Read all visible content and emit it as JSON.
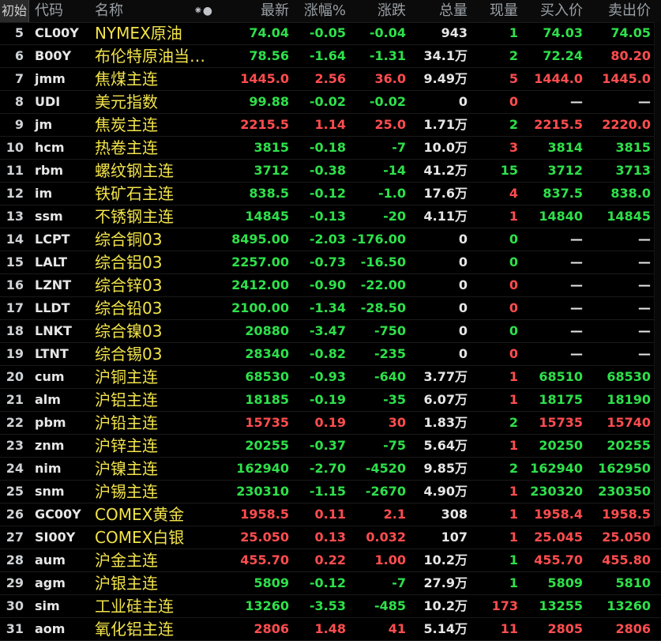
{
  "header": {
    "first_button": "初始",
    "code": "代码",
    "name": "名称",
    "icons": "⁕●",
    "last": "最新",
    "pct": "涨幅%",
    "chg": "涨跌",
    "vol": "总量",
    "now": "现量",
    "bid": "买入价",
    "ask": "卖出价"
  },
  "colors": {
    "up": "#ff4d4f",
    "down": "#2ee04b",
    "flat": "#e6e6e6",
    "name": "#f2e34a"
  },
  "rows": [
    {
      "idx": "5",
      "code": "CL00Y",
      "name": "NYMEX原油",
      "last": "74.04",
      "last_dir": "down",
      "pct": "-0.05",
      "pct_dir": "down",
      "chg": "-0.04",
      "chg_dir": "down",
      "vol": "943",
      "now": "1",
      "now_dir": "down",
      "bid": "74.03",
      "bid_dir": "down",
      "ask": "74.05",
      "ask_dir": "down"
    },
    {
      "idx": "6",
      "code": "B00Y",
      "name": "布伦特原油当…",
      "last": "78.56",
      "last_dir": "down",
      "pct": "-1.64",
      "pct_dir": "down",
      "chg": "-1.31",
      "chg_dir": "down",
      "vol": "34.1万",
      "now": "2",
      "now_dir": "down",
      "bid": "72.24",
      "bid_dir": "down",
      "ask": "80.20",
      "ask_dir": "up"
    },
    {
      "idx": "7",
      "code": "jmm",
      "name": "焦煤主连",
      "last": "1445.0",
      "last_dir": "up",
      "pct": "2.56",
      "pct_dir": "up",
      "chg": "36.0",
      "chg_dir": "up",
      "vol": "9.49万",
      "now": "5",
      "now_dir": "up",
      "bid": "1444.0",
      "bid_dir": "up",
      "ask": "1445.0",
      "ask_dir": "up"
    },
    {
      "idx": "8",
      "code": "UDI",
      "name": "美元指数",
      "last": "99.88",
      "last_dir": "down",
      "pct": "-0.02",
      "pct_dir": "down",
      "chg": "-0.02",
      "chg_dir": "down",
      "vol": "0",
      "now": "0",
      "now_dir": "up",
      "bid": "—",
      "bid_dir": "flat",
      "ask": "—",
      "ask_dir": "flat"
    },
    {
      "idx": "9",
      "code": "jm",
      "name": "焦炭主连",
      "last": "2215.5",
      "last_dir": "up",
      "pct": "1.14",
      "pct_dir": "up",
      "chg": "25.0",
      "chg_dir": "up",
      "vol": "1.71万",
      "now": "2",
      "now_dir": "down",
      "bid": "2215.5",
      "bid_dir": "up",
      "ask": "2220.0",
      "ask_dir": "up"
    },
    {
      "idx": "10",
      "code": "hcm",
      "name": "热卷主连",
      "last": "3815",
      "last_dir": "down",
      "pct": "-0.18",
      "pct_dir": "down",
      "chg": "-7",
      "chg_dir": "down",
      "vol": "10.0万",
      "now": "3",
      "now_dir": "up",
      "bid": "3814",
      "bid_dir": "down",
      "ask": "3815",
      "ask_dir": "down"
    },
    {
      "idx": "11",
      "code": "rbm",
      "name": "螺纹钢主连",
      "last": "3712",
      "last_dir": "down",
      "pct": "-0.38",
      "pct_dir": "down",
      "chg": "-14",
      "chg_dir": "down",
      "vol": "41.2万",
      "now": "15",
      "now_dir": "down",
      "bid": "3712",
      "bid_dir": "down",
      "ask": "3713",
      "ask_dir": "down"
    },
    {
      "idx": "12",
      "code": "im",
      "name": "铁矿石主连",
      "last": "838.5",
      "last_dir": "down",
      "pct": "-0.12",
      "pct_dir": "down",
      "chg": "-1.0",
      "chg_dir": "down",
      "vol": "17.6万",
      "now": "4",
      "now_dir": "up",
      "bid": "837.5",
      "bid_dir": "down",
      "ask": "838.0",
      "ask_dir": "down"
    },
    {
      "idx": "13",
      "code": "ssm",
      "name": "不锈钢主连",
      "last": "14845",
      "last_dir": "down",
      "pct": "-0.13",
      "pct_dir": "down",
      "chg": "-20",
      "chg_dir": "down",
      "vol": "4.11万",
      "now": "1",
      "now_dir": "up",
      "bid": "14840",
      "bid_dir": "down",
      "ask": "14845",
      "ask_dir": "down"
    },
    {
      "idx": "14",
      "code": "LCPT",
      "name": "综合铜03",
      "last": "8495.00",
      "last_dir": "down",
      "pct": "-2.03",
      "pct_dir": "down",
      "chg": "-176.00",
      "chg_dir": "down",
      "vol": "0",
      "now": "0",
      "now_dir": "down",
      "bid": "—",
      "bid_dir": "flat",
      "ask": "—",
      "ask_dir": "flat"
    },
    {
      "idx": "15",
      "code": "LALT",
      "name": "综合铝03",
      "last": "2257.00",
      "last_dir": "down",
      "pct": "-0.73",
      "pct_dir": "down",
      "chg": "-16.50",
      "chg_dir": "down",
      "vol": "0",
      "now": "0",
      "now_dir": "down",
      "bid": "—",
      "bid_dir": "flat",
      "ask": "—",
      "ask_dir": "flat"
    },
    {
      "idx": "16",
      "code": "LZNT",
      "name": "综合锌03",
      "last": "2412.00",
      "last_dir": "down",
      "pct": "-0.90",
      "pct_dir": "down",
      "chg": "-22.00",
      "chg_dir": "down",
      "vol": "0",
      "now": "0",
      "now_dir": "up",
      "bid": "—",
      "bid_dir": "flat",
      "ask": "—",
      "ask_dir": "flat"
    },
    {
      "idx": "17",
      "code": "LLDT",
      "name": "综合铅03",
      "last": "2100.00",
      "last_dir": "down",
      "pct": "-1.34",
      "pct_dir": "down",
      "chg": "-28.50",
      "chg_dir": "down",
      "vol": "0",
      "now": "0",
      "now_dir": "up",
      "bid": "—",
      "bid_dir": "flat",
      "ask": "—",
      "ask_dir": "flat"
    },
    {
      "idx": "18",
      "code": "LNKT",
      "name": "综合镍03",
      "last": "20880",
      "last_dir": "down",
      "pct": "-3.47",
      "pct_dir": "down",
      "chg": "-750",
      "chg_dir": "down",
      "vol": "0",
      "now": "0",
      "now_dir": "down",
      "bid": "—",
      "bid_dir": "flat",
      "ask": "—",
      "ask_dir": "flat"
    },
    {
      "idx": "19",
      "code": "LTNT",
      "name": "综合锡03",
      "last": "28340",
      "last_dir": "down",
      "pct": "-0.82",
      "pct_dir": "down",
      "chg": "-235",
      "chg_dir": "down",
      "vol": "0",
      "now": "0",
      "now_dir": "up",
      "bid": "—",
      "bid_dir": "flat",
      "ask": "—",
      "ask_dir": "flat"
    },
    {
      "idx": "20",
      "code": "cum",
      "name": "沪铜主连",
      "last": "68530",
      "last_dir": "down",
      "pct": "-0.93",
      "pct_dir": "down",
      "chg": "-640",
      "chg_dir": "down",
      "vol": "3.77万",
      "now": "1",
      "now_dir": "up",
      "bid": "68510",
      "bid_dir": "down",
      "ask": "68530",
      "ask_dir": "down"
    },
    {
      "idx": "21",
      "code": "alm",
      "name": "沪铝主连",
      "last": "18185",
      "last_dir": "down",
      "pct": "-0.19",
      "pct_dir": "down",
      "chg": "-35",
      "chg_dir": "down",
      "vol": "6.07万",
      "now": "1",
      "now_dir": "up",
      "bid": "18175",
      "bid_dir": "down",
      "ask": "18190",
      "ask_dir": "down"
    },
    {
      "idx": "22",
      "code": "pbm",
      "name": "沪铅主连",
      "last": "15735",
      "last_dir": "up",
      "pct": "0.19",
      "pct_dir": "up",
      "chg": "30",
      "chg_dir": "up",
      "vol": "1.83万",
      "now": "2",
      "now_dir": "down",
      "bid": "15735",
      "bid_dir": "up",
      "ask": "15740",
      "ask_dir": "up"
    },
    {
      "idx": "23",
      "code": "znm",
      "name": "沪锌主连",
      "last": "20255",
      "last_dir": "down",
      "pct": "-0.37",
      "pct_dir": "down",
      "chg": "-75",
      "chg_dir": "down",
      "vol": "5.64万",
      "now": "1",
      "now_dir": "up",
      "bid": "20250",
      "bid_dir": "down",
      "ask": "20255",
      "ask_dir": "down"
    },
    {
      "idx": "24",
      "code": "nim",
      "name": "沪镍主连",
      "last": "162940",
      "last_dir": "down",
      "pct": "-2.70",
      "pct_dir": "down",
      "chg": "-4520",
      "chg_dir": "down",
      "vol": "9.85万",
      "now": "2",
      "now_dir": "down",
      "bid": "162940",
      "bid_dir": "down",
      "ask": "162950",
      "ask_dir": "down"
    },
    {
      "idx": "25",
      "code": "snm",
      "name": "沪锡主连",
      "last": "230310",
      "last_dir": "down",
      "pct": "-1.15",
      "pct_dir": "down",
      "chg": "-2670",
      "chg_dir": "down",
      "vol": "4.90万",
      "now": "1",
      "now_dir": "up",
      "bid": "230320",
      "bid_dir": "down",
      "ask": "230350",
      "ask_dir": "down"
    },
    {
      "idx": "26",
      "code": "GC00Y",
      "name": "COMEX黄金",
      "last": "1958.5",
      "last_dir": "up",
      "pct": "0.11",
      "pct_dir": "up",
      "chg": "2.1",
      "chg_dir": "up",
      "vol": "308",
      "now": "1",
      "now_dir": "up",
      "bid": "1958.4",
      "bid_dir": "up",
      "ask": "1958.5",
      "ask_dir": "up"
    },
    {
      "idx": "27",
      "code": "SI00Y",
      "name": "COMEX白银",
      "last": "25.050",
      "last_dir": "up",
      "pct": "0.13",
      "pct_dir": "up",
      "chg": "0.032",
      "chg_dir": "up",
      "vol": "107",
      "now": "1",
      "now_dir": "up",
      "bid": "25.045",
      "bid_dir": "up",
      "ask": "25.050",
      "ask_dir": "up"
    },
    {
      "idx": "28",
      "code": "aum",
      "name": "沪金主连",
      "last": "455.70",
      "last_dir": "up",
      "pct": "0.22",
      "pct_dir": "up",
      "chg": "1.00",
      "chg_dir": "up",
      "vol": "10.2万",
      "now": "1",
      "now_dir": "down",
      "bid": "455.70",
      "bid_dir": "up",
      "ask": "455.80",
      "ask_dir": "up"
    },
    {
      "idx": "29",
      "code": "agm",
      "name": "沪银主连",
      "last": "5809",
      "last_dir": "down",
      "pct": "-0.12",
      "pct_dir": "down",
      "chg": "-7",
      "chg_dir": "down",
      "vol": "27.9万",
      "now": "1",
      "now_dir": "down",
      "bid": "5809",
      "bid_dir": "down",
      "ask": "5810",
      "ask_dir": "down"
    },
    {
      "idx": "30",
      "code": "sim",
      "name": "工业硅主连",
      "last": "13260",
      "last_dir": "down",
      "pct": "-3.53",
      "pct_dir": "down",
      "chg": "-485",
      "chg_dir": "down",
      "vol": "10.2万",
      "now": "173",
      "now_dir": "up",
      "bid": "13255",
      "bid_dir": "down",
      "ask": "13260",
      "ask_dir": "down"
    },
    {
      "idx": "31",
      "code": "aom",
      "name": "氧化铝主连",
      "last": "2806",
      "last_dir": "up",
      "pct": "1.48",
      "pct_dir": "up",
      "chg": "41",
      "chg_dir": "up",
      "vol": "5.14万",
      "now": "11",
      "now_dir": "up",
      "bid": "2805",
      "bid_dir": "up",
      "ask": "2806",
      "ask_dir": "up"
    }
  ]
}
